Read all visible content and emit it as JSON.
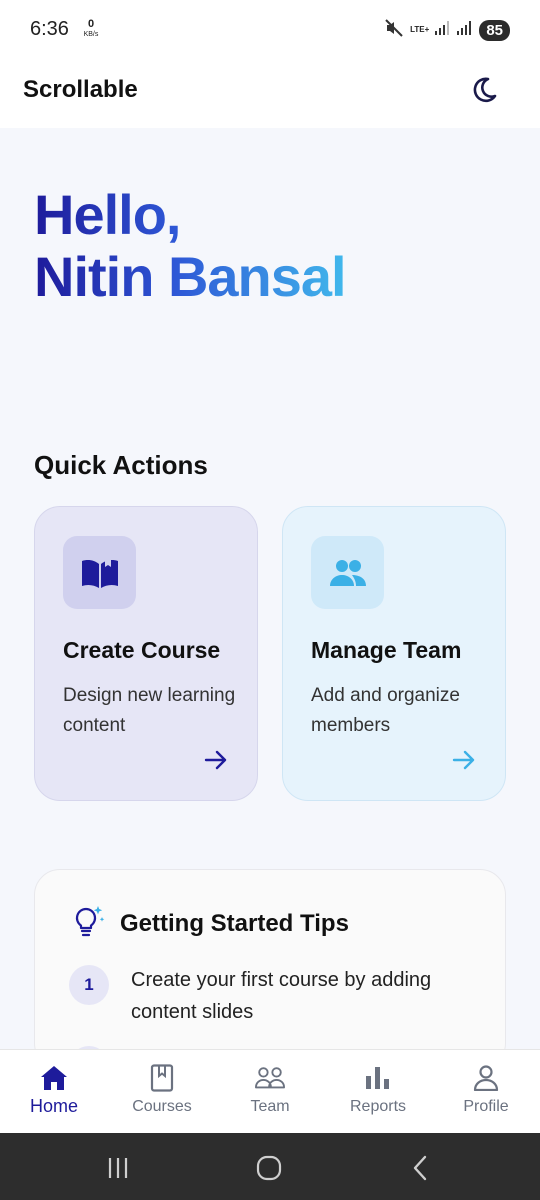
{
  "status_bar": {
    "time": "6:36",
    "net_speed_value": "0",
    "net_speed_unit": "KB/s",
    "network": "LTE+",
    "battery": "85"
  },
  "app_bar": {
    "title": "Scrollable",
    "theme_toggle_icon": "moon-icon"
  },
  "greeting": {
    "line1": "Hello,",
    "line2": "Nitin Bansal"
  },
  "quick_actions": {
    "title": "Quick Actions",
    "cards": [
      {
        "title": "Create Course",
        "description": "Design new learning content",
        "icon": "open-book-icon",
        "arrow_color": "#1e1b9b"
      },
      {
        "title": "Manage Team",
        "description": "Add and organize members",
        "icon": "people-icon",
        "arrow_color": "#3bb0e6"
      }
    ]
  },
  "tips": {
    "title": "Getting Started Tips",
    "icon": "lightbulb-icon",
    "items": [
      {
        "number": "1",
        "text": "Create your first course by adding content slides"
      }
    ]
  },
  "bottom_nav": {
    "items": [
      {
        "label": "Home",
        "icon": "home-icon",
        "active": true
      },
      {
        "label": "Courses",
        "icon": "book-icon",
        "active": false
      },
      {
        "label": "Team",
        "icon": "team-icon",
        "active": false
      },
      {
        "label": "Reports",
        "icon": "bar-chart-icon",
        "active": false
      },
      {
        "label": "Profile",
        "icon": "person-icon",
        "active": false
      }
    ]
  },
  "colors": {
    "accent": "#1e1b9b",
    "accent_light": "#41b8ec",
    "background": "#f5f7fc"
  }
}
